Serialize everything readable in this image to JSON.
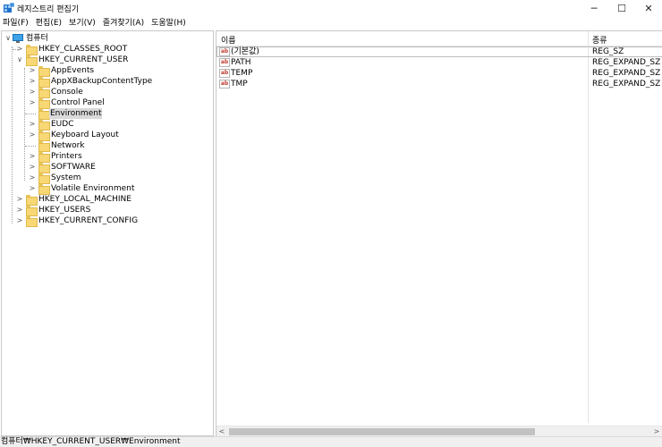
{
  "window": {
    "title": "레지스트리 편집기",
    "minimize_glyph": "─",
    "maximize_glyph": "☐",
    "close_glyph": "✕"
  },
  "menu": [
    {
      "label": "파일(F)"
    },
    {
      "label": "편집(E)"
    },
    {
      "label": "보기(V)"
    },
    {
      "label": "즐겨찾기(A)"
    },
    {
      "label": "도움말(H)"
    }
  ],
  "tree": {
    "root": {
      "label": "컴퓨터",
      "expander": "∨"
    },
    "nodes": [
      {
        "label": "HKEY_CLASSES_ROOT",
        "expander": ">"
      },
      {
        "label": "HKEY_CURRENT_USER",
        "expander": "∨"
      },
      {
        "label": "AppEvents",
        "expander": ">"
      },
      {
        "label": "AppXBackupContentType",
        "expander": ">"
      },
      {
        "label": "Console",
        "expander": ">"
      },
      {
        "label": "Control Panel",
        "expander": ">"
      },
      {
        "label": "Environment",
        "expander": "",
        "selected": true
      },
      {
        "label": "EUDC",
        "expander": ">"
      },
      {
        "label": "Keyboard Layout",
        "expander": ">"
      },
      {
        "label": "Network",
        "expander": ""
      },
      {
        "label": "Printers",
        "expander": ">"
      },
      {
        "label": "SOFTWARE",
        "expander": ">"
      },
      {
        "label": "System",
        "expander": ">"
      },
      {
        "label": "Volatile Environment",
        "expander": ">"
      },
      {
        "label": "HKEY_LOCAL_MACHINE",
        "expander": ">"
      },
      {
        "label": "HKEY_USERS",
        "expander": ">"
      },
      {
        "label": "HKEY_CURRENT_CONFIG",
        "expander": ">"
      }
    ]
  },
  "list": {
    "columns": {
      "name": "이름",
      "type": "종류"
    },
    "rows": [
      {
        "name": "(기본값)",
        "type": "REG_SZ",
        "icon": "ab"
      },
      {
        "name": "PATH",
        "type": "REG_EXPAND_SZ",
        "icon": "ab"
      },
      {
        "name": "TEMP",
        "type": "REG_EXPAND_SZ",
        "icon": "ab"
      },
      {
        "name": "TMP",
        "type": "REG_EXPAND_SZ",
        "icon": "ab"
      }
    ]
  },
  "scrollbar": {
    "left_glyph": "<",
    "right_glyph": ">"
  },
  "status": {
    "path": "컴퓨터₩HKEY_CURRENT_USER₩Environment"
  }
}
